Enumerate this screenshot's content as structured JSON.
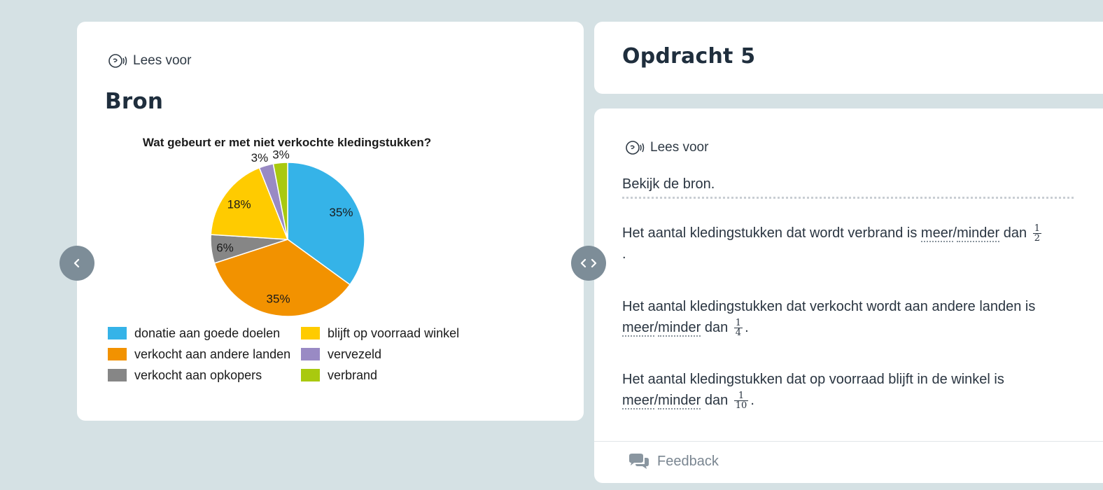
{
  "bron_panel": {
    "read_aloud": "Lees voor",
    "heading": "Bron"
  },
  "chart_data": {
    "type": "pie",
    "title": "Wat gebeurt er met niet verkochte kledingstukken?",
    "slices": [
      {
        "label": "donatie aan goede doelen",
        "value": 35,
        "value_label": "35%",
        "color": "#35b3e8"
      },
      {
        "label": "verkocht aan andere landen",
        "value": 35,
        "value_label": "35%",
        "color": "#f29200"
      },
      {
        "label": "verkocht aan opkopers",
        "value": 6,
        "value_label": "6%",
        "color": "#868686"
      },
      {
        "label": "blijft op voorraad winkel",
        "value": 18,
        "value_label": "18%",
        "color": "#ffcb00"
      },
      {
        "label": "vervezeld",
        "value": 3,
        "value_label": "3%",
        "color": "#998ac4"
      },
      {
        "label": "verbrand",
        "value": 3,
        "value_label": "3%",
        "color": "#a9c90f"
      }
    ],
    "legend_order": [
      0,
      3,
      1,
      4,
      2,
      5
    ],
    "legend_position": "bottom"
  },
  "opdracht": {
    "title": "Opdracht 5",
    "read_aloud": "Lees voor",
    "instruction": "Bekijk de bron.",
    "choice_a": "meer",
    "choice_sep": "/",
    "choice_b": "minder",
    "word_dan": "dan",
    "period": ".",
    "questions": [
      {
        "text": "Het aantal kledingstukken dat wordt verbrand is",
        "numerator": "1",
        "denominator": "2"
      },
      {
        "text": "Het aantal kledingstukken dat verkocht wordt aan andere landen is",
        "numerator": "1",
        "denominator": "4"
      },
      {
        "text": "Het aantal kledingstukken dat op voorraad blijft in de winkel is",
        "numerator": "1",
        "denominator": "10"
      }
    ],
    "feedback_label": "Feedback"
  },
  "colors": {
    "background": "#d5e1e4",
    "card": "#ffffff",
    "nav_button": "#7d8d98"
  },
  "icons": {
    "read_aloud": "speaking-head-icon",
    "prev": "chevron-left-icon",
    "split": "chevron-left-right-icon",
    "feedback": "chat-bubbles-icon"
  }
}
